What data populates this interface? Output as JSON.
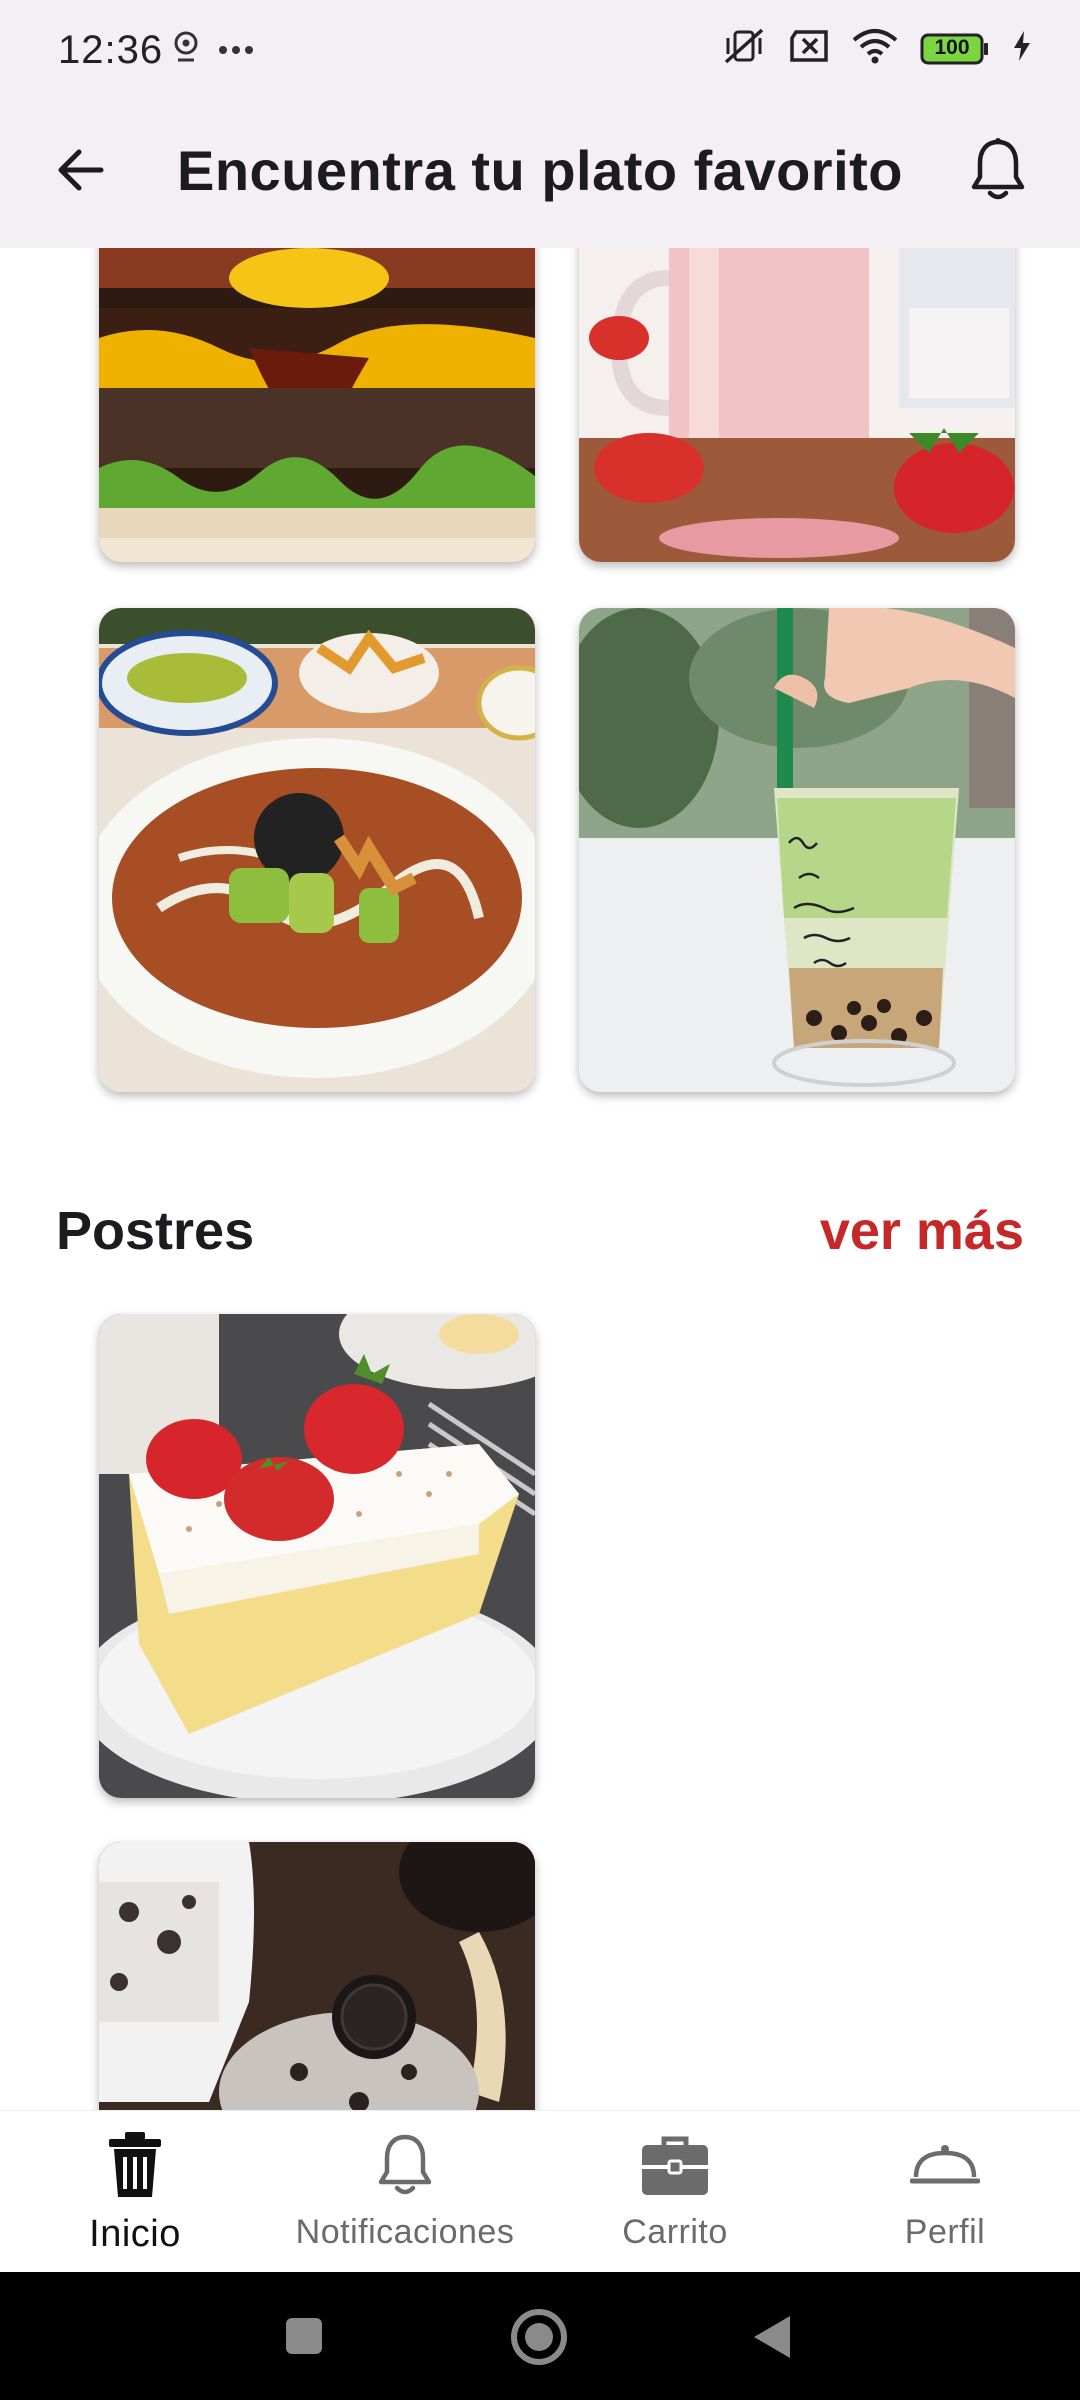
{
  "status_bar": {
    "time": "12:36",
    "battery": "100",
    "icons": [
      "location-icon",
      "more-dots-icon",
      "vibrate-off-icon",
      "sim-x-icon",
      "wifi-icon",
      "battery-icon",
      "charging-icon"
    ]
  },
  "app_bar": {
    "title": "Encuentra tu plato favorito",
    "back_icon": "arrow-left-icon",
    "notification_icon": "bell-icon"
  },
  "sections": [
    {
      "items": [
        {
          "image": "burger-photo"
        },
        {
          "image": "strawberry-milkshake-photo"
        },
        {
          "image": "tortilla-soup-photo"
        },
        {
          "image": "matcha-bubble-tea-photo"
        }
      ]
    },
    {
      "title": "Postres",
      "see_more": "ver más",
      "items": [
        {
          "image": "tres-leches-cake-photo"
        },
        {
          "image": "cookies-and-cream-ice-cream-photo"
        }
      ]
    }
  ],
  "bottom_nav": {
    "items": [
      {
        "label": "Inicio",
        "icon": "trash-can-icon",
        "active": true
      },
      {
        "label": "Notificaciones",
        "icon": "bell-icon",
        "active": false
      },
      {
        "label": "Carrito",
        "icon": "briefcase-icon",
        "active": false
      },
      {
        "label": "Perfil",
        "icon": "cloche-icon",
        "active": false
      }
    ]
  },
  "system_nav": {
    "icons": [
      "recents-square-icon",
      "home-circle-icon",
      "back-triangle-icon"
    ]
  },
  "colors": {
    "app_bar_bg": "#f4eff4",
    "accent_red": "#c62828",
    "text_dark": "#1c1b1f",
    "nav_inactive": "#6b6b6b"
  }
}
